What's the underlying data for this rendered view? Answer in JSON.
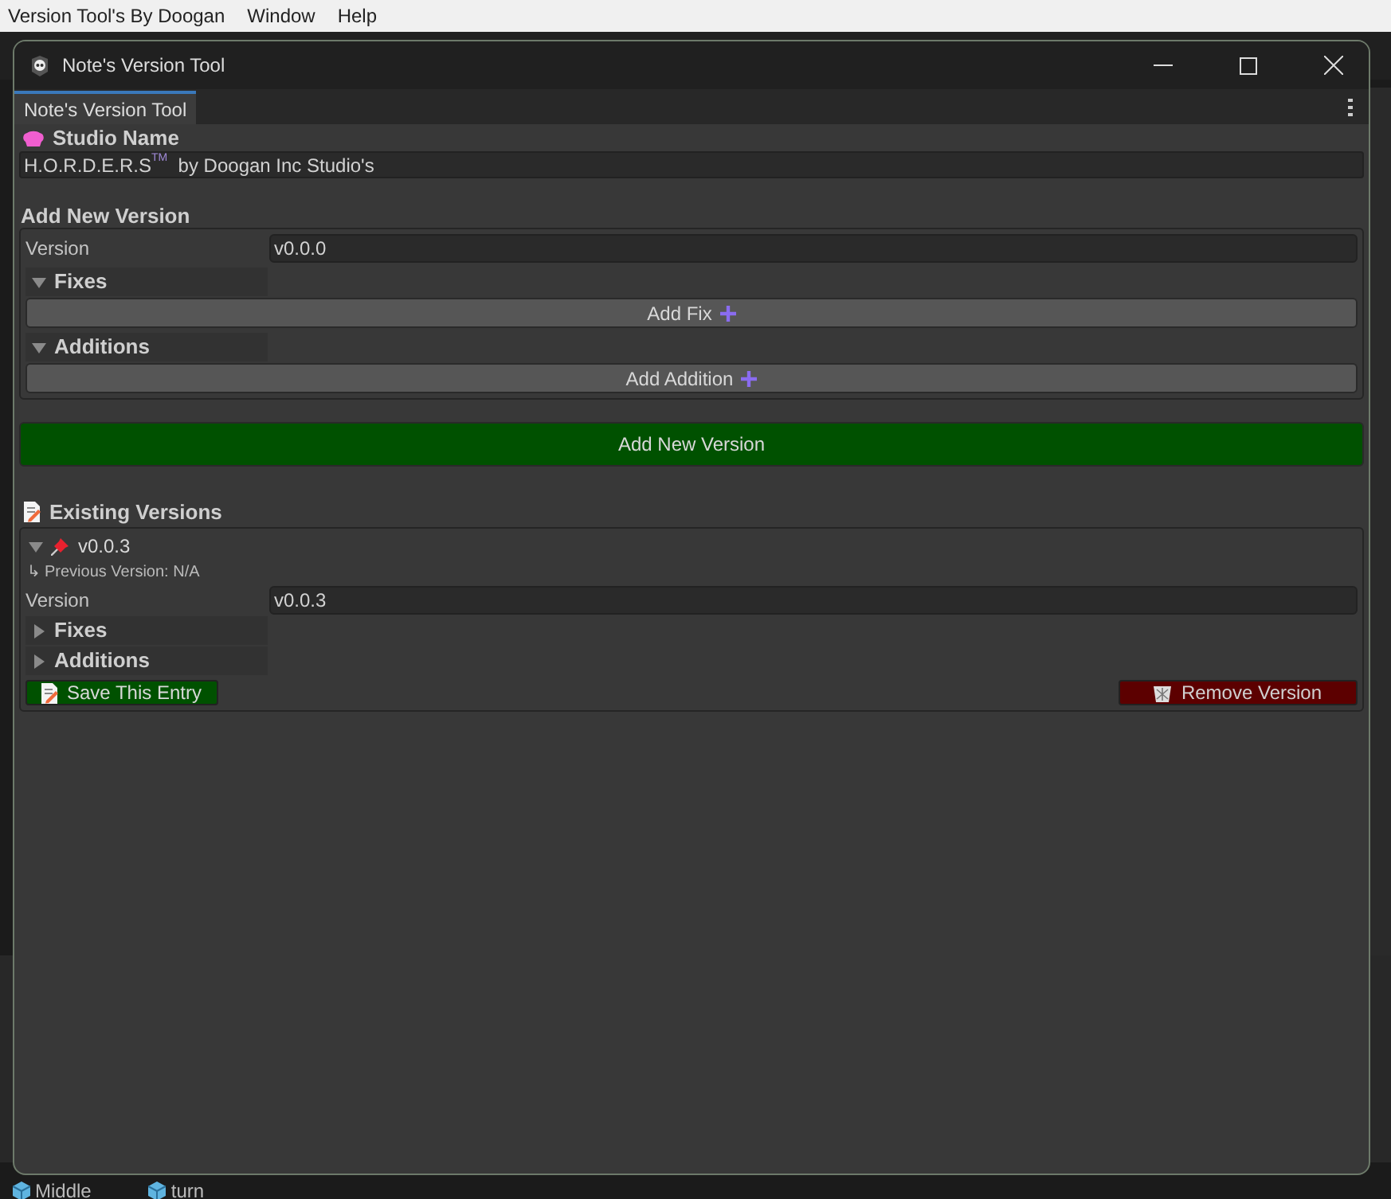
{
  "menu_bar": [
    {
      "label": "Version Tool's By Doogan"
    },
    {
      "label": "Window"
    },
    {
      "label": "Help"
    }
  ],
  "window": {
    "title": "Note's Version Tool"
  },
  "tabs": [
    {
      "label": "Note's Version Tool",
      "selected": true
    }
  ],
  "studio": {
    "heading": "Studio Name",
    "value": "H.O.R.D.E.R.S$^{TM}$  by Doogan Inc Studio's"
  },
  "add_new": {
    "heading": "Add New Version",
    "version_label": "Version",
    "version_value": "v0.0.0",
    "sections": [
      {
        "label": "Fixes",
        "expanded": true,
        "button": "Add Fix"
      },
      {
        "label": "Additions",
        "expanded": true,
        "button": "Add Addition"
      }
    ],
    "submit": "Add New Version"
  },
  "existing": {
    "heading": "Existing Versions",
    "entries": [
      {
        "title": "v0.0.3",
        "expanded": true,
        "previous_arrow": "↳",
        "previous": "Previous Version: N/A",
        "version_label": "Version",
        "version_value": "v0.0.3",
        "sections": [
          {
            "label": "Fixes",
            "expanded": false
          },
          {
            "label": "Additions",
            "expanded": false
          }
        ],
        "save_button": "Save This Entry",
        "remove_button": "Remove Version"
      }
    ]
  },
  "background_items": [
    {
      "label": "Middle"
    },
    {
      "label": "turn"
    }
  ]
}
